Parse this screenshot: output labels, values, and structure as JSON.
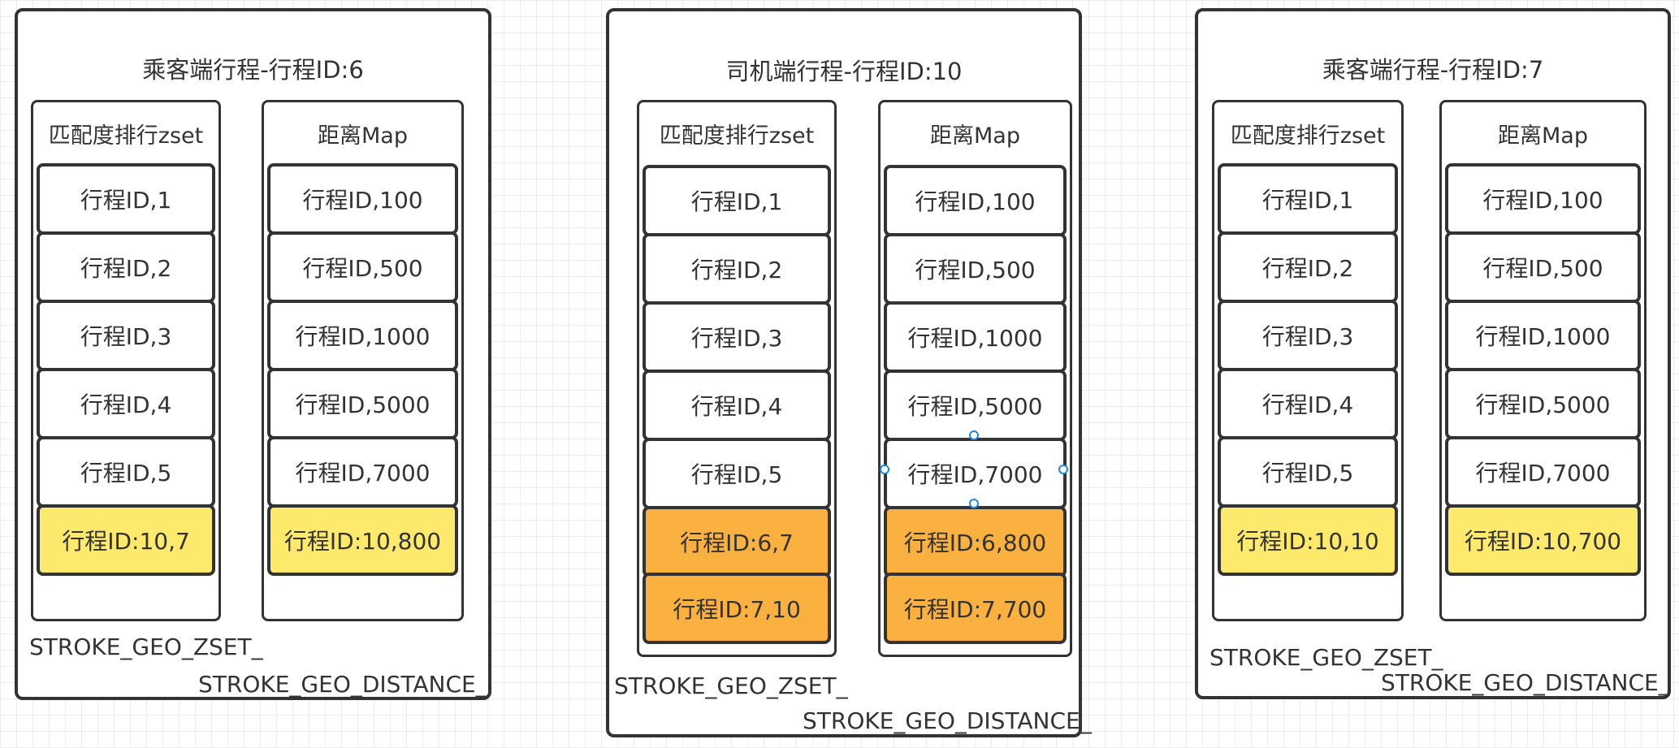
{
  "panels": [
    {
      "title": "乘客端行程-行程ID:6",
      "zset": {
        "title": "匹配度排行zset",
        "items": [
          "行程ID,1",
          "行程ID,2",
          "行程ID,3",
          "行程ID,4",
          "行程ID,5",
          "行程ID:10,7"
        ],
        "highlight": [
          "none",
          "none",
          "none",
          "none",
          "none",
          "yellow"
        ]
      },
      "map": {
        "title": "距离Map",
        "items": [
          "行程ID,100",
          "行程ID,500",
          "行程ID,1000",
          "行程ID,5000",
          "行程ID,7000",
          "行程ID:10,800"
        ],
        "highlight": [
          "none",
          "none",
          "none",
          "none",
          "none",
          "yellow"
        ]
      },
      "labels": [
        "STROKE_GEO_ZSET_",
        "STROKE_GEO_DISTANCE_"
      ]
    },
    {
      "title": "司机端行程-行程ID:10",
      "zset": {
        "title": "匹配度排行zset",
        "items": [
          "行程ID,1",
          "行程ID,2",
          "行程ID,3",
          "行程ID,4",
          "行程ID,5",
          "行程ID:6,7",
          "行程ID:7,10"
        ],
        "highlight": [
          "none",
          "none",
          "none",
          "none",
          "none",
          "orange",
          "orange"
        ]
      },
      "map": {
        "title": "距离Map",
        "items": [
          "行程ID,100",
          "行程ID,500",
          "行程ID,1000",
          "行程ID,5000",
          "行程ID,7000",
          "行程ID:6,800",
          "行程ID:7,700"
        ],
        "highlight": [
          "none",
          "none",
          "none",
          "none",
          "none",
          "orange",
          "orange"
        ]
      },
      "labels": [
        "STROKE_GEO_ZSET_",
        "STROKE_GEO_DISTANCE_"
      ]
    },
    {
      "title": "乘客端行程-行程ID:7",
      "zset": {
        "title": "匹配度排行zset",
        "items": [
          "行程ID,1",
          "行程ID,2",
          "行程ID,3",
          "行程ID,4",
          "行程ID,5",
          "行程ID:10,10"
        ],
        "highlight": [
          "none",
          "none",
          "none",
          "none",
          "none",
          "yellow"
        ]
      },
      "map": {
        "title": "距离Map",
        "items": [
          "行程ID,100",
          "行程ID,500",
          "行程ID,1000",
          "行程ID,5000",
          "行程ID,7000",
          "行程ID:10,700"
        ],
        "highlight": [
          "none",
          "none",
          "none",
          "none",
          "none",
          "yellow"
        ]
      },
      "labels": [
        "STROKE_GEO_ZSET_",
        "STROKE_GEO_DISTANCE_"
      ]
    }
  ],
  "colors": {
    "yellow": "#fdea6d",
    "orange": "#fbb140",
    "border": "#333333",
    "selection": "#1e88e5"
  }
}
